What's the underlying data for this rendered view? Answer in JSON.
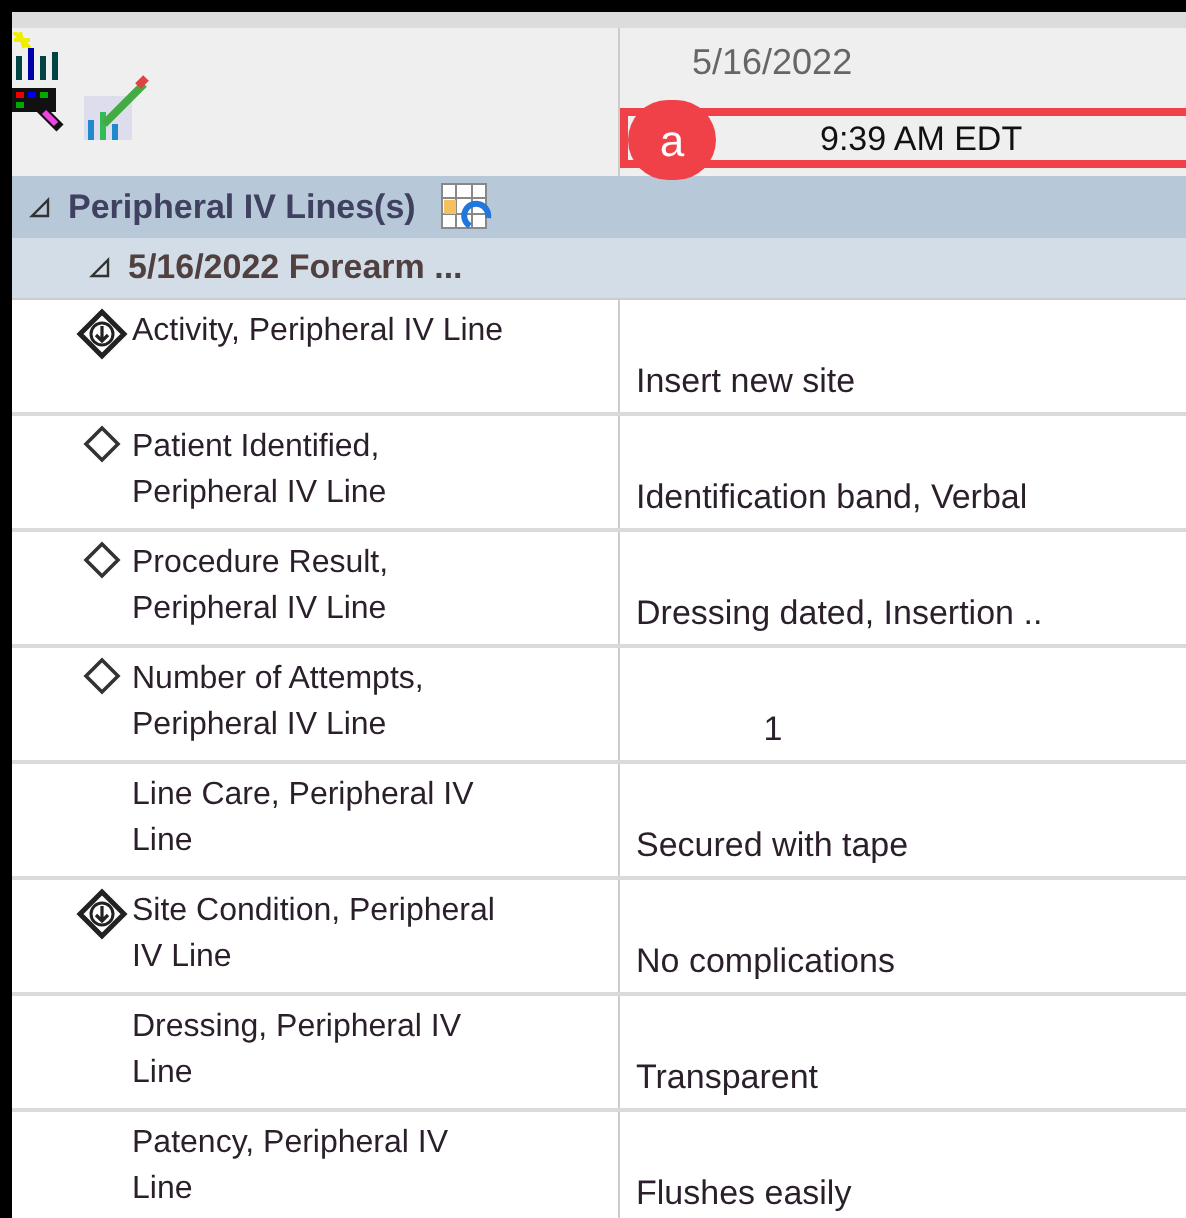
{
  "header": {
    "date": "5/16/2022",
    "time": "9:39 AM EDT",
    "callout": "a"
  },
  "section": {
    "title": "Peripheral IV Lines(s)",
    "expanded": true
  },
  "subsection": {
    "title": "5/16/2022 Forearm ...",
    "expanded": true
  },
  "rows": [
    {
      "label": "Activity, Peripheral IV Line",
      "kind": "required",
      "value": "Insert new site",
      "centered": false
    },
    {
      "label": "Patient Identified, Peripheral IV Line",
      "kind": "optional",
      "value": "Identification band, Verbal",
      "centered": false
    },
    {
      "label": "Procedure Result, Peripheral IV Line",
      "kind": "optional",
      "value": "Dressing dated, Insertion ..",
      "centered": false
    },
    {
      "label": "Number of Attempts, Peripheral IV Line",
      "kind": "optional",
      "value": "1",
      "centered": true
    },
    {
      "label": "Line Care, Peripheral IV Line",
      "kind": "none",
      "value": "Secured with tape",
      "centered": false
    },
    {
      "label": "Site Condition, Peripheral IV Line",
      "kind": "required",
      "value": "No complications",
      "centered": false
    },
    {
      "label": "Dressing, Peripheral IV Line",
      "kind": "none",
      "value": "Transparent",
      "centered": false
    },
    {
      "label": "Patency, Peripheral IV Line",
      "kind": "none",
      "value": "Flushes easily",
      "centered": false
    }
  ]
}
